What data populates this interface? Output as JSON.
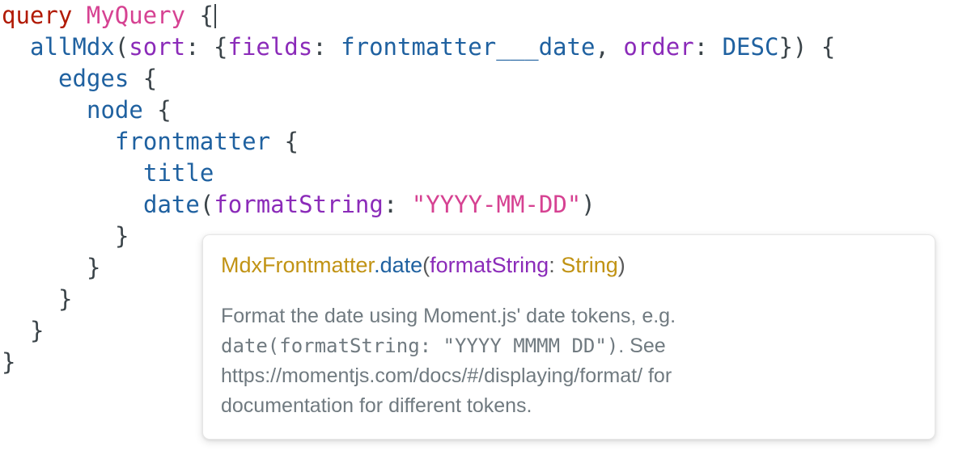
{
  "editor": {
    "name": "graphiql-query-editor",
    "background_color": "#ffffff",
    "colors": {
      "keyword": "#b11a04",
      "definition": "#d64292",
      "field": "#1f61a0",
      "attribute": "#8b2bb9",
      "string": "#d64292",
      "punctuation": "#3b4449",
      "enum": "#1f61a0"
    },
    "lines": [
      {
        "indent": 0,
        "tokens": [
          {
            "t": "query",
            "k": "keyword"
          },
          {
            "t": " ",
            "k": "punct"
          },
          {
            "t": "MyQuery",
            "k": "def"
          },
          {
            "t": " ",
            "k": "punct"
          },
          {
            "t": "{",
            "k": "punct"
          },
          {
            "t": "",
            "k": "caret"
          }
        ]
      },
      {
        "indent": 1,
        "tokens": [
          {
            "t": "allMdx",
            "k": "field"
          },
          {
            "t": "(",
            "k": "punct"
          },
          {
            "t": "sort",
            "k": "attr"
          },
          {
            "t": ": {",
            "k": "punct"
          },
          {
            "t": "fields",
            "k": "attr"
          },
          {
            "t": ": ",
            "k": "punct"
          },
          {
            "t": "frontmatter___date",
            "k": "enum"
          },
          {
            "t": ", ",
            "k": "punct"
          },
          {
            "t": "order",
            "k": "attr"
          },
          {
            "t": ": ",
            "k": "punct"
          },
          {
            "t": "DESC",
            "k": "enum"
          },
          {
            "t": "}) {",
            "k": "punct"
          }
        ]
      },
      {
        "indent": 2,
        "tokens": [
          {
            "t": "edges",
            "k": "field"
          },
          {
            "t": " {",
            "k": "punct"
          }
        ]
      },
      {
        "indent": 3,
        "tokens": [
          {
            "t": "node",
            "k": "field"
          },
          {
            "t": " {",
            "k": "punct"
          }
        ]
      },
      {
        "indent": 4,
        "tokens": [
          {
            "t": "frontmatter",
            "k": "field"
          },
          {
            "t": " {",
            "k": "punct"
          }
        ]
      },
      {
        "indent": 5,
        "tokens": [
          {
            "t": "title",
            "k": "field"
          }
        ]
      },
      {
        "indent": 5,
        "tokens": [
          {
            "t": "date",
            "k": "field"
          },
          {
            "t": "(",
            "k": "punct"
          },
          {
            "t": "formatString",
            "k": "attr"
          },
          {
            "t": ": ",
            "k": "punct"
          },
          {
            "t": "\"YYYY-MM-DD\"",
            "k": "string"
          },
          {
            "t": ")",
            "k": "punct"
          }
        ]
      },
      {
        "indent": 4,
        "tokens": [
          {
            "t": "}",
            "k": "punct"
          }
        ]
      },
      {
        "indent": 3,
        "tokens": [
          {
            "t": "}",
            "k": "punct"
          }
        ]
      },
      {
        "indent": 2,
        "tokens": [
          {
            "t": "}",
            "k": "punct"
          }
        ]
      },
      {
        "indent": 1,
        "tokens": [
          {
            "t": "}",
            "k": "punct"
          }
        ]
      },
      {
        "indent": 0,
        "tokens": [
          {
            "t": "}",
            "k": "punct"
          }
        ]
      }
    ]
  },
  "doc_popup": {
    "name": "field-documentation-tooltip",
    "title": {
      "parent_type": "MdxFrontmatter",
      "dot": ".",
      "field": "date",
      "open_paren": "(",
      "arg_name": "formatString",
      "arg_colon": ": ",
      "arg_type": "String",
      "close_paren": ")"
    },
    "description": {
      "part1": "Format the date using Moment.js' date tokens, e.g. ",
      "code1": "date(formatString: \"YYYY MMMM DD\")",
      "part2": ". See https://momentjs.com/docs/#/displaying/format/ for documentation for different tokens."
    },
    "colors": {
      "type_name": "#c19314",
      "field_name": "#1f61a0",
      "arg_name": "#8b2bb9",
      "body_text": "#707a80",
      "panel_background": "#ffffff",
      "panel_border": "#e6e6e6"
    }
  }
}
